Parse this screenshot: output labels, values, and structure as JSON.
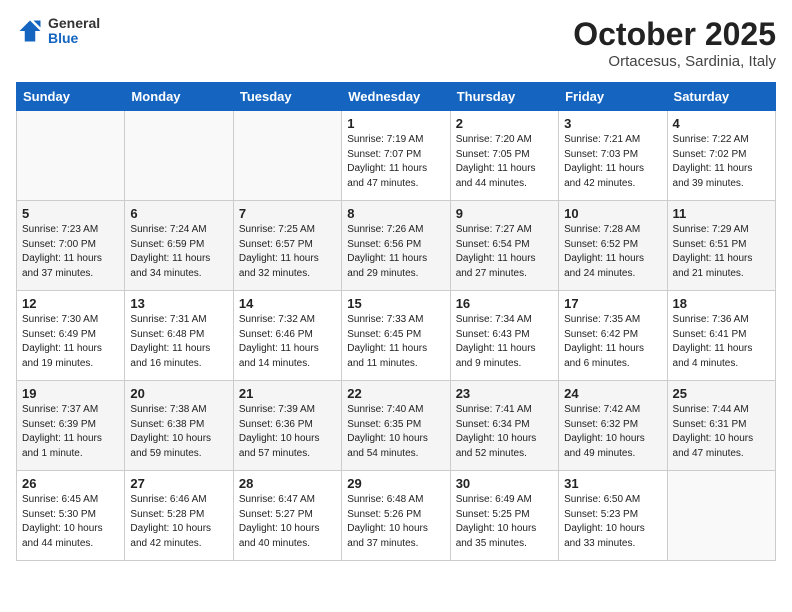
{
  "header": {
    "logo_general": "General",
    "logo_blue": "Blue",
    "month_title": "October 2025",
    "location": "Ortacesus, Sardinia, Italy"
  },
  "days_of_week": [
    "Sunday",
    "Monday",
    "Tuesday",
    "Wednesday",
    "Thursday",
    "Friday",
    "Saturday"
  ],
  "weeks": [
    [
      {
        "day": "",
        "info": ""
      },
      {
        "day": "",
        "info": ""
      },
      {
        "day": "",
        "info": ""
      },
      {
        "day": "1",
        "info": "Sunrise: 7:19 AM\nSunset: 7:07 PM\nDaylight: 11 hours and 47 minutes."
      },
      {
        "day": "2",
        "info": "Sunrise: 7:20 AM\nSunset: 7:05 PM\nDaylight: 11 hours and 44 minutes."
      },
      {
        "day": "3",
        "info": "Sunrise: 7:21 AM\nSunset: 7:03 PM\nDaylight: 11 hours and 42 minutes."
      },
      {
        "day": "4",
        "info": "Sunrise: 7:22 AM\nSunset: 7:02 PM\nDaylight: 11 hours and 39 minutes."
      }
    ],
    [
      {
        "day": "5",
        "info": "Sunrise: 7:23 AM\nSunset: 7:00 PM\nDaylight: 11 hours and 37 minutes."
      },
      {
        "day": "6",
        "info": "Sunrise: 7:24 AM\nSunset: 6:59 PM\nDaylight: 11 hours and 34 minutes."
      },
      {
        "day": "7",
        "info": "Sunrise: 7:25 AM\nSunset: 6:57 PM\nDaylight: 11 hours and 32 minutes."
      },
      {
        "day": "8",
        "info": "Sunrise: 7:26 AM\nSunset: 6:56 PM\nDaylight: 11 hours and 29 minutes."
      },
      {
        "day": "9",
        "info": "Sunrise: 7:27 AM\nSunset: 6:54 PM\nDaylight: 11 hours and 27 minutes."
      },
      {
        "day": "10",
        "info": "Sunrise: 7:28 AM\nSunset: 6:52 PM\nDaylight: 11 hours and 24 minutes."
      },
      {
        "day": "11",
        "info": "Sunrise: 7:29 AM\nSunset: 6:51 PM\nDaylight: 11 hours and 21 minutes."
      }
    ],
    [
      {
        "day": "12",
        "info": "Sunrise: 7:30 AM\nSunset: 6:49 PM\nDaylight: 11 hours and 19 minutes."
      },
      {
        "day": "13",
        "info": "Sunrise: 7:31 AM\nSunset: 6:48 PM\nDaylight: 11 hours and 16 minutes."
      },
      {
        "day": "14",
        "info": "Sunrise: 7:32 AM\nSunset: 6:46 PM\nDaylight: 11 hours and 14 minutes."
      },
      {
        "day": "15",
        "info": "Sunrise: 7:33 AM\nSunset: 6:45 PM\nDaylight: 11 hours and 11 minutes."
      },
      {
        "day": "16",
        "info": "Sunrise: 7:34 AM\nSunset: 6:43 PM\nDaylight: 11 hours and 9 minutes."
      },
      {
        "day": "17",
        "info": "Sunrise: 7:35 AM\nSunset: 6:42 PM\nDaylight: 11 hours and 6 minutes."
      },
      {
        "day": "18",
        "info": "Sunrise: 7:36 AM\nSunset: 6:41 PM\nDaylight: 11 hours and 4 minutes."
      }
    ],
    [
      {
        "day": "19",
        "info": "Sunrise: 7:37 AM\nSunset: 6:39 PM\nDaylight: 11 hours and 1 minute."
      },
      {
        "day": "20",
        "info": "Sunrise: 7:38 AM\nSunset: 6:38 PM\nDaylight: 10 hours and 59 minutes."
      },
      {
        "day": "21",
        "info": "Sunrise: 7:39 AM\nSunset: 6:36 PM\nDaylight: 10 hours and 57 minutes."
      },
      {
        "day": "22",
        "info": "Sunrise: 7:40 AM\nSunset: 6:35 PM\nDaylight: 10 hours and 54 minutes."
      },
      {
        "day": "23",
        "info": "Sunrise: 7:41 AM\nSunset: 6:34 PM\nDaylight: 10 hours and 52 minutes."
      },
      {
        "day": "24",
        "info": "Sunrise: 7:42 AM\nSunset: 6:32 PM\nDaylight: 10 hours and 49 minutes."
      },
      {
        "day": "25",
        "info": "Sunrise: 7:44 AM\nSunset: 6:31 PM\nDaylight: 10 hours and 47 minutes."
      }
    ],
    [
      {
        "day": "26",
        "info": "Sunrise: 6:45 AM\nSunset: 5:30 PM\nDaylight: 10 hours and 44 minutes."
      },
      {
        "day": "27",
        "info": "Sunrise: 6:46 AM\nSunset: 5:28 PM\nDaylight: 10 hours and 42 minutes."
      },
      {
        "day": "28",
        "info": "Sunrise: 6:47 AM\nSunset: 5:27 PM\nDaylight: 10 hours and 40 minutes."
      },
      {
        "day": "29",
        "info": "Sunrise: 6:48 AM\nSunset: 5:26 PM\nDaylight: 10 hours and 37 minutes."
      },
      {
        "day": "30",
        "info": "Sunrise: 6:49 AM\nSunset: 5:25 PM\nDaylight: 10 hours and 35 minutes."
      },
      {
        "day": "31",
        "info": "Sunrise: 6:50 AM\nSunset: 5:23 PM\nDaylight: 10 hours and 33 minutes."
      },
      {
        "day": "",
        "info": ""
      }
    ]
  ]
}
